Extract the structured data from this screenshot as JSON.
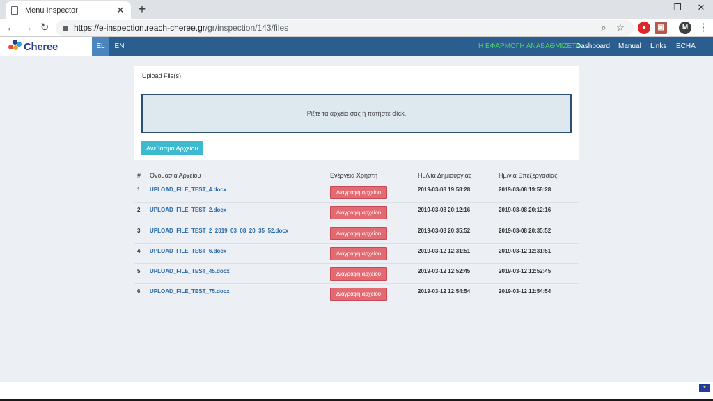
{
  "browser": {
    "tab_title": "Menu Inspector",
    "new_tab_label": "+",
    "url_host": "https://e-inspection.reach-cheree.gr",
    "url_path": "/gr/inspection/143/files",
    "profile_initial": "M",
    "window_controls": {
      "minimize": "–",
      "restore": "❐",
      "close": "✕"
    }
  },
  "nav": {
    "brand": "Cheree",
    "languages": [
      {
        "label": "EL",
        "active": true
      },
      {
        "label": "EN",
        "active": false
      }
    ],
    "notice": "Η ΕΦΑΡΜΟΓΗ ΑΝΑΒΑΘΜΙΖΕΤΑΙ",
    "links": [
      "Dashboard",
      "Manual",
      "Links",
      "ECHA"
    ],
    "colors": {
      "bar": "#2c5d8f",
      "active_lang": "#4a85bf",
      "notice": "#4bd06a"
    }
  },
  "upload": {
    "title": "Upload File(s)",
    "dropzone_text": "Ρίξτε τα αρχεία σας ή πατήστε click.",
    "button_label": "Ανέβασμα Αρχείου"
  },
  "table": {
    "headers": {
      "num": "#",
      "name": "Ονομασία Αρχείου",
      "action": "Ενέργεια Χρήστη",
      "created": "Ημ/νία Δημιουργίας",
      "modified": "Ημ/νία Επεξεργασίας"
    },
    "delete_label": "Διαγραφή αρχείου",
    "rows": [
      {
        "num": "1",
        "name": "UPLOAD_FILE_TEST_4.docx",
        "created": "2019-03-08 19:58:28",
        "modified": "2019-03-08 19:58:28"
      },
      {
        "num": "2",
        "name": "UPLOAD_FILE_TEST_2.docx",
        "created": "2019-03-08 20:12:16",
        "modified": "2019-03-08 20:12:16"
      },
      {
        "num": "3",
        "name": "UPLOAD_FILE_TEST_2_2019_03_08_20_35_52.docx",
        "created": "2019-03-08 20:35:52",
        "modified": "2019-03-08 20:35:52"
      },
      {
        "num": "4",
        "name": "UPLOAD_FILE_TEST_6.docx",
        "created": "2019-03-12 12:31:51",
        "modified": "2019-03-12 12:31:51"
      },
      {
        "num": "5",
        "name": "UPLOAD_FILE_TEST_45.docx",
        "created": "2019-03-12 12:52:45",
        "modified": "2019-03-12 12:52:45"
      },
      {
        "num": "6",
        "name": "UPLOAD_FILE_TEST_75.docx",
        "created": "2019-03-12 12:54:54",
        "modified": "2019-03-12 12:54:54"
      }
    ]
  }
}
